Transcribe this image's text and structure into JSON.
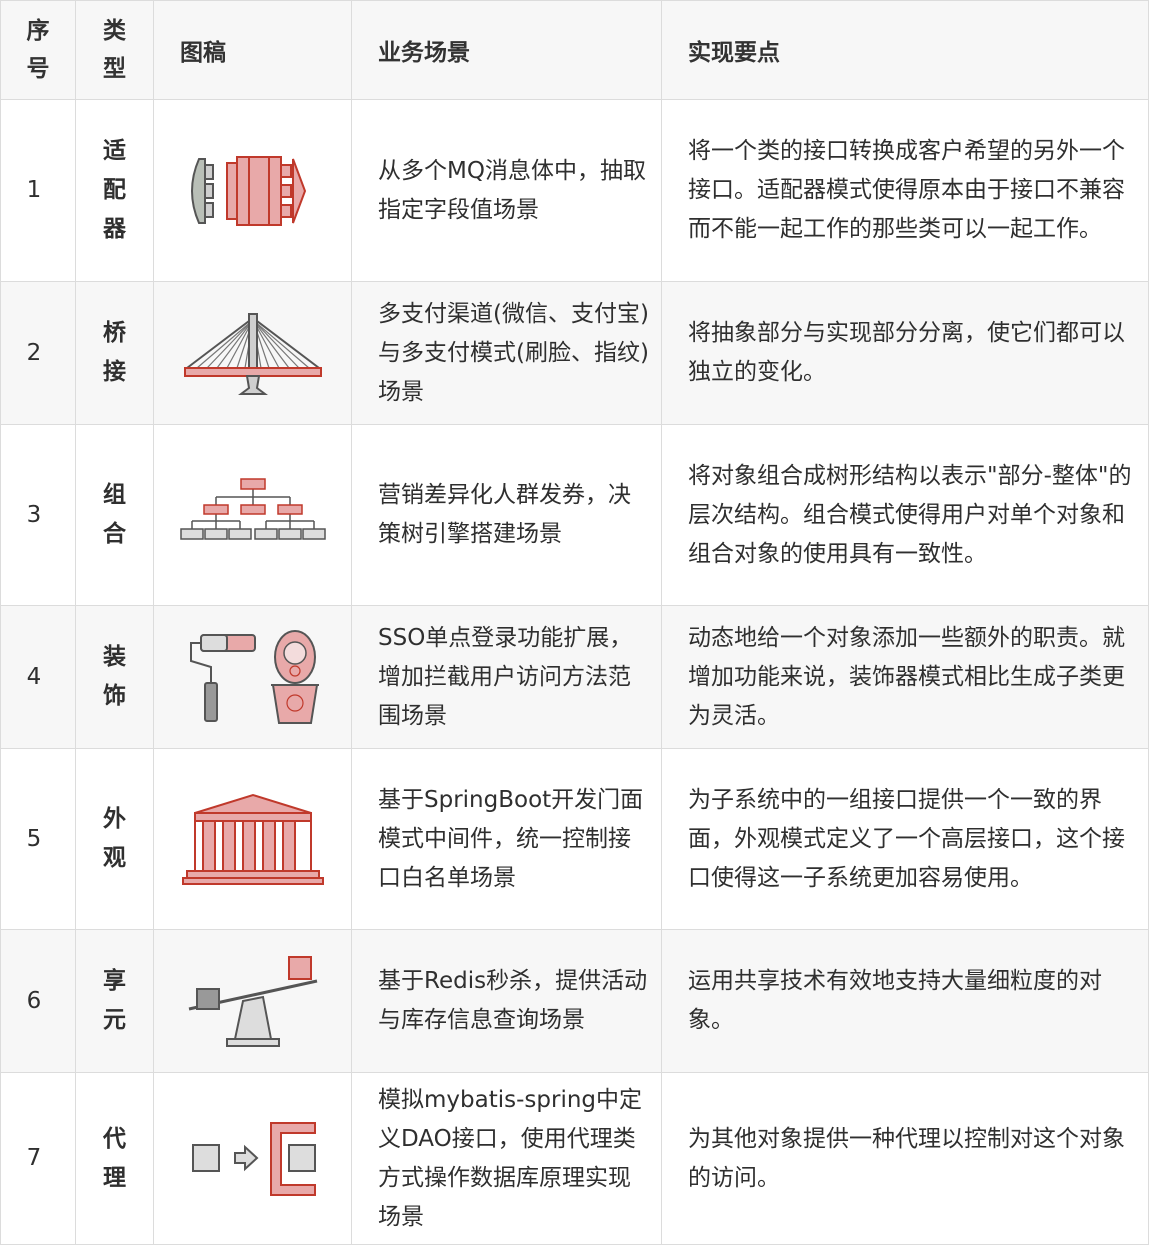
{
  "header": {
    "no": "序号",
    "type": "类型",
    "icon": "图稿",
    "scene": "业务场景",
    "points": "实现要点"
  },
  "colors": {
    "accent_red": "#d9534f",
    "accent_pink": "#e8a9a9",
    "icon_gray": "#5a5a5a",
    "row_alt_bg": "#f7f7f7"
  },
  "rows": [
    {
      "no": "1",
      "type": "适配器",
      "icon": "adapter-icon",
      "scene": "从多个MQ消息体中，抽取指定字段值场景",
      "points": "将一个类的接口转换成客户希望的另外一个接口。适配器模式使得原本由于接口不兼容而不能一起工作的那些类可以一起工作。"
    },
    {
      "no": "2",
      "type": "桥接",
      "icon": "bridge-icon",
      "scene": "多支付渠道(微信、支付宝)与多支付模式(刷脸、指纹)场景",
      "points": "将抽象部分与实现部分分离，使它们都可以独立的变化。"
    },
    {
      "no": "3",
      "type": "组合",
      "icon": "tree-icon",
      "scene": "营销差异化人群发券，决策树引擎搭建场景",
      "points": "将对象组合成树形结构以表示\"部分-整体\"的层次结构。组合模式使得用户对单个对象和组合对象的使用具有一致性。"
    },
    {
      "no": "4",
      "type": "装饰",
      "icon": "paint-roller-doll-icon",
      "scene": "SSO单点登录功能扩展，增加拦截用户访问方法范围场景",
      "points": "动态地给一个对象添加一些额外的职责。就增加功能来说，装饰器模式相比生成子类更为灵活。"
    },
    {
      "no": "5",
      "type": "外观",
      "icon": "building-facade-icon",
      "scene": "基于SpringBoot开发门面模式中间件，统一控制接口白名单场景",
      "points": "为子系统中的一组接口提供一个一致的界面，外观模式定义了一个高层接口，这个接口使得这一子系统更加容易使用。"
    },
    {
      "no": "6",
      "type": "享元",
      "icon": "seesaw-icon",
      "scene": "基于Redis秒杀，提供活动与库存信息查询场景",
      "points": "运用共享技术有效地支持大量细粒度的对象。"
    },
    {
      "no": "7",
      "type": "代理",
      "icon": "proxy-icon",
      "scene": "模拟mybatis-spring中定义DAO接口，使用代理类方式操作数据库原理实现场景",
      "points": "为其他对象提供一种代理以控制对这个对象的访问。"
    }
  ]
}
